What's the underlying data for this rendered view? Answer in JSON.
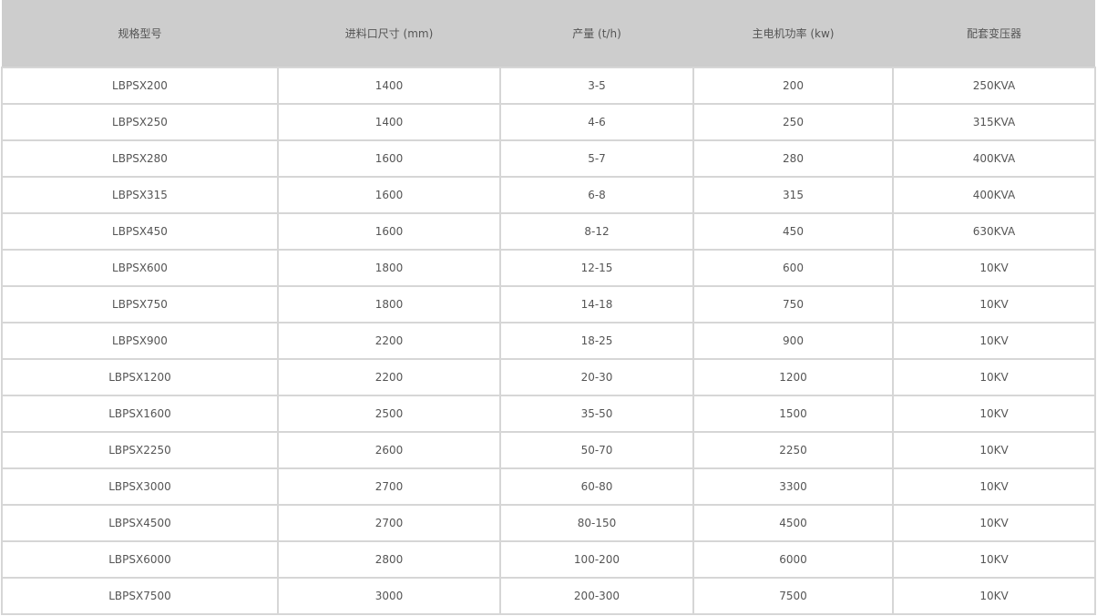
{
  "table": {
    "headers": [
      "规格型号",
      "进料口尺寸 (mm)",
      "产量 (t/h)",
      "主电机功率 (kw)",
      "配套变压器"
    ],
    "rows": [
      [
        "LBPSX200",
        "1400",
        "3-5",
        "200",
        "250KVA"
      ],
      [
        "LBPSX250",
        "1400",
        "4-6",
        "250",
        "315KVA"
      ],
      [
        "LBPSX280",
        "1600",
        "5-7",
        "280",
        "400KVA"
      ],
      [
        "LBPSX315",
        "1600",
        "6-8",
        "315",
        "400KVA"
      ],
      [
        "LBPSX450",
        "1600",
        "8-12",
        "450",
        "630KVA"
      ],
      [
        "LBPSX600",
        "1800",
        "12-15",
        "600",
        "10KV"
      ],
      [
        "LBPSX750",
        "1800",
        "14-18",
        "750",
        "10KV"
      ],
      [
        "LBPSX900",
        "2200",
        "18-25",
        "900",
        "10KV"
      ],
      [
        "LBPSX1200",
        "2200",
        "20-30",
        "1200",
        "10KV"
      ],
      [
        "LBPSX1600",
        "2500",
        "35-50",
        "1500",
        "10KV"
      ],
      [
        "LBPSX2250",
        "2600",
        "50-70",
        "2250",
        "10KV"
      ],
      [
        "LBPSX3000",
        "2700",
        "60-80",
        "3300",
        "10KV"
      ],
      [
        "LBPSX4500",
        "2700",
        "80-150",
        "4500",
        "10KV"
      ],
      [
        "LBPSX6000",
        "2800",
        "100-200",
        "6000",
        "10KV"
      ],
      [
        "LBPSX7500",
        "3000",
        "200-300",
        "7500",
        "10KV"
      ]
    ]
  },
  "colors": {
    "header_bg": "#cdcdcd",
    "border": "#d6d6d6",
    "text": "#555555"
  }
}
